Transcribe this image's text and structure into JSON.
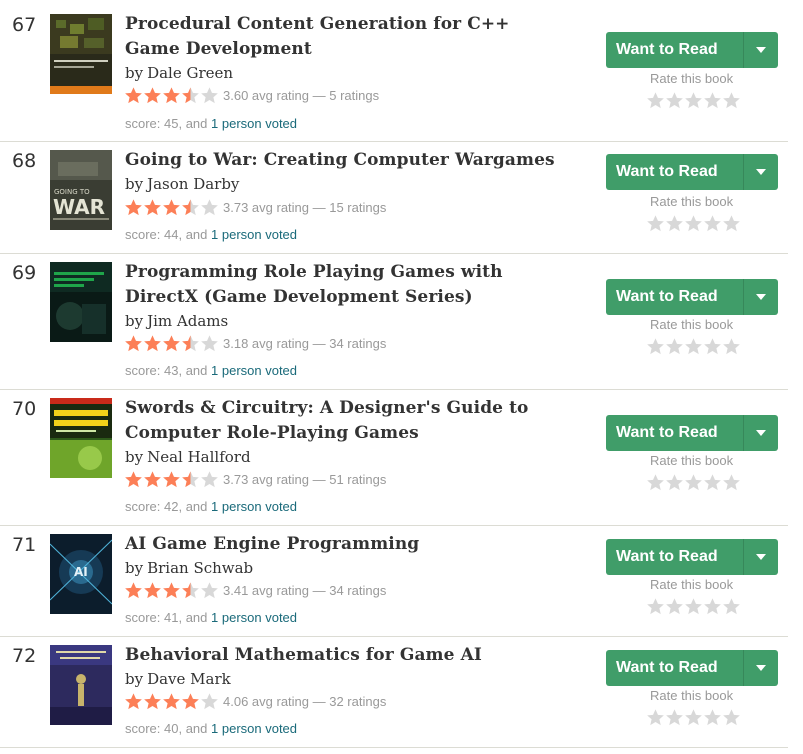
{
  "books": [
    {
      "rank": "67",
      "title": "Procedural Content Generation for C++ Game Development",
      "by": "by",
      "author": "Dale Green",
      "avg_rating": 3.6,
      "rating_text": "3.60 avg rating — 5 ratings",
      "score_text": "score: 45, and",
      "voters_text": "1 person voted"
    },
    {
      "rank": "68",
      "title": "Going to War: Creating Computer Wargames",
      "by": "by",
      "author": "Jason Darby",
      "avg_rating": 3.73,
      "rating_text": "3.73 avg rating — 15 ratings",
      "score_text": "score: 44, and",
      "voters_text": "1 person voted"
    },
    {
      "rank": "69",
      "title": "Programming Role Playing Games with DirectX (Game Development Series)",
      "by": "by",
      "author": "Jim Adams",
      "avg_rating": 3.18,
      "rating_text": "3.18 avg rating — 34 ratings",
      "score_text": "score: 43, and",
      "voters_text": "1 person voted"
    },
    {
      "rank": "70",
      "title": "Swords & Circuitry: A Designer's Guide to Computer Role-Playing Games",
      "by": "by",
      "author": "Neal Hallford",
      "avg_rating": 3.73,
      "rating_text": "3.73 avg rating — 51 ratings",
      "score_text": "score: 42, and",
      "voters_text": "1 person voted"
    },
    {
      "rank": "71",
      "title": "AI Game Engine Programming",
      "by": "by",
      "author": "Brian Schwab",
      "avg_rating": 3.41,
      "rating_text": "3.41 avg rating — 34 ratings",
      "score_text": "score: 41, and",
      "voters_text": "1 person voted"
    },
    {
      "rank": "72",
      "title": "Behavioral Mathematics for Game AI",
      "by": "by",
      "author": "Dave Mark",
      "avg_rating": 4.06,
      "rating_text": "4.06 avg rating — 32 ratings",
      "score_text": "score: 40, and",
      "voters_text": "1 person voted"
    }
  ],
  "actions": {
    "want_to_read": "Want to Read",
    "rate_this_book": "Rate this book",
    "dropdown_icon": "caret-down-icon",
    "star_icon": "star-icon"
  },
  "colors": {
    "button_green": "#409d69",
    "star_filled": "#fc7f57",
    "star_empty": "#d8d8d8",
    "link": "#1a6a7a",
    "muted_text": "#999999"
  },
  "covers": [
    {
      "icon": "book-cover-procedural-content",
      "bg": "#2a2a1a",
      "accent": "#e07a1a"
    },
    {
      "icon": "book-cover-going-to-war",
      "bg": "#3a3d33",
      "accent": "#d9d9c9"
    },
    {
      "icon": "book-cover-rpg-directx",
      "bg": "#0a1a16",
      "accent": "#1fa54a"
    },
    {
      "icon": "book-cover-swords-circuitry",
      "bg": "#2e5a1a",
      "accent": "#f2d21a"
    },
    {
      "icon": "book-cover-ai-engine",
      "bg": "#0c1d2c",
      "accent": "#4fb3d9"
    },
    {
      "icon": "book-cover-behavioral-math",
      "bg": "#2d2a5e",
      "accent": "#c7b36b"
    }
  ]
}
